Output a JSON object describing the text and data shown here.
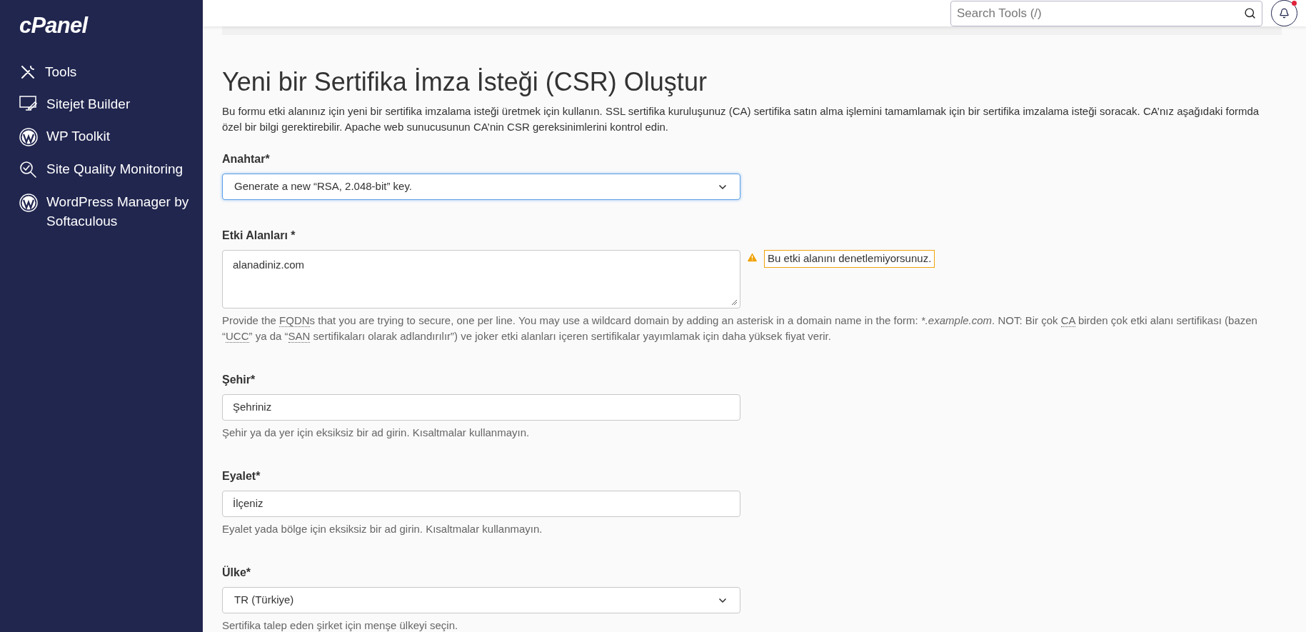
{
  "sidebar": {
    "logo": "cPanel",
    "items": [
      {
        "label": "Tools"
      },
      {
        "label": "Sitejet Builder"
      },
      {
        "label": "WP Toolkit"
      },
      {
        "label": "Site Quality Monitoring"
      },
      {
        "label": "WordPress Manager by Softaculous"
      }
    ]
  },
  "header": {
    "search": {
      "placeholder": "Search Tools (/)"
    },
    "notifications": {
      "unread": true
    }
  },
  "page": {
    "title": "Yeni bir Sertifika İmza İsteği (CSR) Oluştur",
    "description": "Bu formu etki alanınız için yeni bir sertifika imzalama isteği üretmek için kullanın. SSL sertifika kuruluşunuz (CA) sertifika satın alma işlemini tamamlamak için bir sertifika imzalama isteği soracak. CA’nız aşağıdaki formda özel bir bilgi gerektirebilir. Apache web sunucusunun CA’nin CSR gereksinimlerini kontrol edin.",
    "fields": [
      {
        "kind": "select",
        "label": "Anahtar*",
        "value": "Generate a new “RSA, 2.048-bit” key.",
        "focused": true
      },
      {
        "kind": "textarea",
        "label": "Etki Alanları *",
        "value": "alanadiniz.com",
        "focused": false,
        "warning": "Bu etki alanını denetlemiyorsunuz.",
        "help": [
          {
            "kind": "text",
            "text": "Provide the "
          },
          {
            "kind": "abbr",
            "text": "FQDN"
          },
          {
            "kind": "text",
            "text": "s that you are trying to secure, one per line. You may use a wildcard domain by adding an asterisk in a domain name in the form: "
          },
          {
            "kind": "em",
            "text": "*.example.com"
          },
          {
            "kind": "text",
            "text": ". NOT: Bir çok "
          },
          {
            "kind": "abbr",
            "text": "CA"
          },
          {
            "kind": "text",
            "text": " birden çok etki alanı sertifikası (bazen “"
          },
          {
            "kind": "abbr",
            "text": "UCC"
          },
          {
            "kind": "text",
            "text": "” ya da “"
          },
          {
            "kind": "abbr",
            "text": "SAN"
          },
          {
            "kind": "text",
            "text": " sertifikaları olarak adlandırılır”) ve joker etki alanları içeren sertifikalar yayımlamak için daha yüksek fiyat verir."
          }
        ]
      },
      {
        "kind": "input",
        "label": "Şehir*",
        "value": "Şehriniz",
        "focused": false,
        "help": [
          {
            "kind": "text",
            "text": "Şehir ya da yer için eksiksiz bir ad girin. Kısaltmalar kullanmayın."
          }
        ]
      },
      {
        "kind": "input",
        "label": "Eyalet*",
        "value": "İlçeniz",
        "focused": false,
        "help": [
          {
            "kind": "text",
            "text": "Eyalet yada bölge için eksiksiz bir ad girin. Kısaltmalar kullanmayın."
          }
        ]
      },
      {
        "kind": "select",
        "label": "Ülke*",
        "value": "TR (Türkiye)",
        "focused": false,
        "help": [
          {
            "kind": "text",
            "text": "Sertifika talep eden şirket için menşe ülkeyi seçin."
          }
        ]
      }
    ]
  }
}
